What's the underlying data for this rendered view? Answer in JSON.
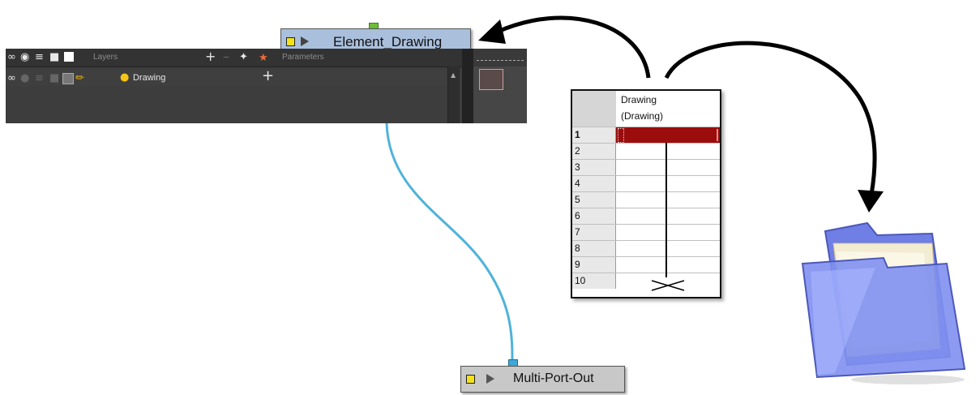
{
  "nodes": {
    "element_drawing": {
      "label": "Element_Drawing",
      "port_color": "#6bbf35",
      "body_color": "#a9bfdc"
    },
    "multi_port_out": {
      "label": "Multi-Port-Out",
      "port_color": "#3fa6d6",
      "body_color": "#c8c8c8"
    }
  },
  "timeline": {
    "layers_header": "Layers",
    "parameters_header": "Parameters",
    "layer": {
      "name": "Drawing"
    },
    "add_icon": "+"
  },
  "xsheet": {
    "column_name": "Drawing",
    "column_subname": "(Drawing)",
    "rows": [
      "1",
      "2",
      "3",
      "4",
      "5",
      "6",
      "7",
      "8",
      "9",
      "10"
    ],
    "exposed_frame_color": "#9b0d0d"
  },
  "colors": {
    "cable": "#4fb3d9",
    "arrow": "#000000",
    "folder": "#6f7fe6"
  },
  "icons": [
    "visibility-icon",
    "lock-icon",
    "color-swatch-icon",
    "pencil-icon",
    "drawing-layer-icon",
    "folder-icon"
  ]
}
